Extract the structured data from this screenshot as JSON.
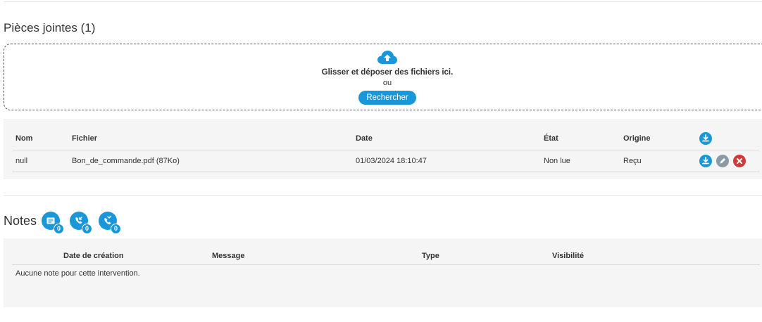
{
  "attachments": {
    "title": "Pièces jointes (1)",
    "dropzone": {
      "upload_icon": "cloud-upload-icon",
      "title": "Glisser et déposer des fichiers ici.",
      "or": "ou",
      "browse_label": "Rechercher"
    },
    "columns": {
      "name": "Nom",
      "file": "Fichier",
      "date": "Date",
      "state": "État",
      "origin": "Origine",
      "download_all_icon": "download-icon"
    },
    "rows": [
      {
        "name": "null",
        "file": "Bon_de_commande.pdf (87Ko)",
        "date": "01/03/2024 18:10:47",
        "state": "Non lue",
        "origin": "Reçu",
        "actions": [
          "download-icon",
          "edit-icon",
          "delete-icon"
        ]
      }
    ]
  },
  "notes": {
    "title": "Notes",
    "badges": [
      {
        "icon": "note-list-icon",
        "count": "0"
      },
      {
        "icon": "phone-incoming-icon",
        "count": "0"
      },
      {
        "icon": "phone-missed-icon",
        "count": "0"
      }
    ],
    "columns": {
      "created": "Date de création",
      "message": "Message",
      "type": "Type",
      "visibility": "Visibilité"
    },
    "empty_text": "Aucune note pour cette intervention."
  },
  "colors": {
    "accent": "#1a97d9",
    "edit": "#8a9aa6",
    "delete": "#d23b3b",
    "panel_bg": "#f5f5f5"
  }
}
